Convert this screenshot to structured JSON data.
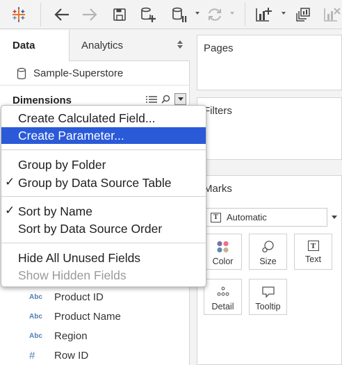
{
  "tabs": {
    "data": "Data",
    "analytics": "Analytics"
  },
  "datasource": {
    "name": "Sample-Superstore"
  },
  "dimensions": {
    "title": "Dimensions"
  },
  "fields": [
    {
      "type": "Abc",
      "name": "Product ID"
    },
    {
      "type": "Abc",
      "name": "Product Name"
    },
    {
      "type": "Abc",
      "name": "Region"
    },
    {
      "type": "#",
      "name": "Row ID"
    }
  ],
  "shelves": {
    "pages": "Pages",
    "filters": "Filters",
    "marks": "Marks"
  },
  "marks": {
    "type_icon": "T",
    "type_value": "Automatic",
    "buttons": {
      "color": "Color",
      "size": "Size",
      "text": "Text",
      "text_icon": "T",
      "detail": "Detail",
      "tooltip": "Tooltip"
    }
  },
  "menu": {
    "create_calculated_field": "Create Calculated Field...",
    "create_parameter": "Create Parameter...",
    "group_by_folder": "Group by Folder",
    "group_by_data_source_table": "Group by Data Source Table",
    "sort_by_name": "Sort by Name",
    "sort_by_data_source_order": "Sort by Data Source Order",
    "hide_all_unused_fields": "Hide All Unused Fields",
    "show_hidden_fields": "Show Hidden Fields",
    "check_mark": "✓"
  },
  "icons": {
    "logo": "tableau-logo-icon",
    "back": "back-arrow-icon",
    "forward": "forward-arrow-icon",
    "save": "save-icon",
    "new_data_source": "new-data-source-icon",
    "pause_updates": "pause-updates-icon",
    "refresh": "refresh-icon",
    "new_worksheet": "new-worksheet-icon",
    "duplicate": "duplicate-icon",
    "clear": "clear-icon"
  },
  "colors": {
    "highlight": "#2a5ad8",
    "field_icon": "#4b7fb4",
    "logo_blue": "#1f4e8c",
    "logo_orange": "#e8762c",
    "logo_teal": "#59879b",
    "logo_red": "#c72035",
    "color_dot_purple": "#7b6fa8",
    "color_dot_pink": "#e7738f",
    "color_dot_blue": "#5d8ab5",
    "color_dot_tan": "#c9b08e"
  }
}
